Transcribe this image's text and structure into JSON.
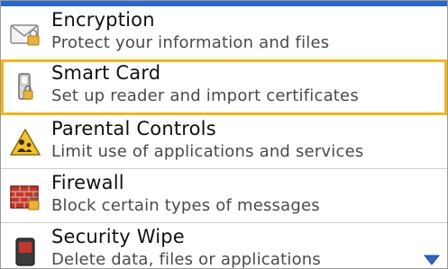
{
  "colors": {
    "accent": "#2e66c6",
    "selection": "#f2b51e",
    "title_text": "#111111",
    "subtitle_text": "#4a4a4a"
  },
  "items": [
    {
      "title": "Encryption",
      "subtitle": "Protect your information and files",
      "icon": "envelope-lock-icon",
      "selected": false
    },
    {
      "title": "Smart Card",
      "subtitle": "Set up reader and import certificates",
      "icon": "smart-card-reader-icon",
      "selected": true
    },
    {
      "title": "Parental Controls",
      "subtitle": "Limit use of applications and services",
      "icon": "parental-controls-icon",
      "selected": false
    },
    {
      "title": "Firewall",
      "subtitle": "Block certain types of messages",
      "icon": "firewall-icon",
      "selected": false
    },
    {
      "title": "Security Wipe",
      "subtitle": "Delete data, files or applications",
      "icon": "security-wipe-icon",
      "selected": false
    }
  ],
  "scroll": {
    "icon": "scroll-down-arrow-icon"
  }
}
